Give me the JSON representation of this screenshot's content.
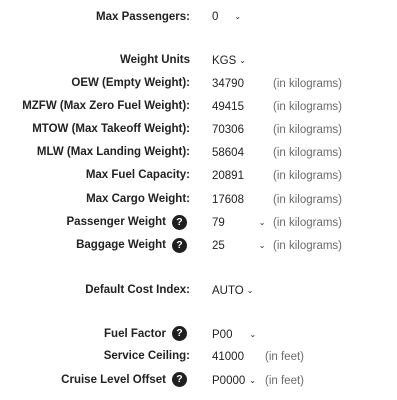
{
  "fields": {
    "max_passengers": {
      "label": "Max Passengers:",
      "value": "0"
    },
    "weight_units": {
      "label": "Weight Units",
      "value": "KGS"
    },
    "oew": {
      "label": "OEW (Empty Weight):",
      "value": "34790",
      "unit": "(in kilograms)"
    },
    "mzfw": {
      "label": "MZFW (Max Zero Fuel Weight):",
      "value": "49415",
      "unit": "(in kilograms)"
    },
    "mtow": {
      "label": "MTOW (Max Takeoff Weight):",
      "value": "70306",
      "unit": "(in kilograms)"
    },
    "mlw": {
      "label": "MLW (Max Landing Weight):",
      "value": "58604",
      "unit": "(in kilograms)"
    },
    "max_fuel": {
      "label": "Max Fuel Capacity:",
      "value": "20891",
      "unit": "(in kilograms)"
    },
    "max_cargo": {
      "label": "Max Cargo Weight:",
      "value": "17608",
      "unit": "(in kilograms)"
    },
    "passenger_weight": {
      "label": "Passenger Weight",
      "value": "79",
      "unit": "(in kilograms)"
    },
    "baggage_weight": {
      "label": "Baggage Weight",
      "value": "25",
      "unit": "(in kilograms)"
    },
    "cost_index": {
      "label": "Default Cost Index:",
      "value": "AUTO"
    },
    "fuel_factor": {
      "label": "Fuel Factor",
      "value": "P00"
    },
    "service_ceiling": {
      "label": "Service Ceiling:",
      "value": "41000",
      "unit": "(in feet)"
    },
    "cruise_offset": {
      "label": "Cruise Level Offset",
      "value": "P0000",
      "unit": "(in feet)"
    }
  },
  "help_symbol": "?",
  "chevron_symbol": "⌄",
  "icons": {
    "help": "help-icon",
    "dropdown": "chevron-down-icon"
  }
}
